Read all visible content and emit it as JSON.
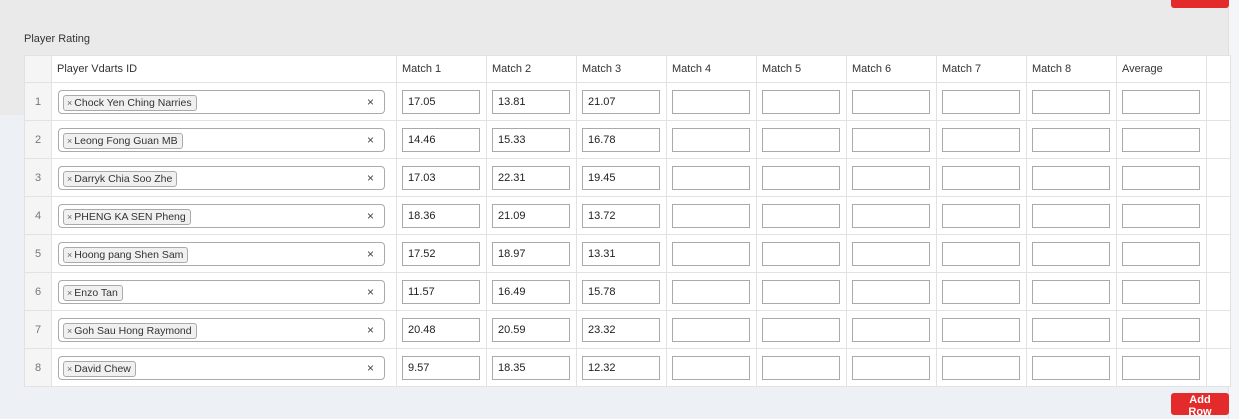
{
  "section_title": "Player Rating",
  "columns": {
    "player": "Player Vdarts ID",
    "matches": [
      "Match 1",
      "Match 2",
      "Match 3",
      "Match 4",
      "Match 5",
      "Match 6",
      "Match 7",
      "Match 8"
    ],
    "average": "Average"
  },
  "rows": [
    {
      "index": "1",
      "player": "Chock Yen Ching Narries",
      "scores": [
        "17.05",
        "13.81",
        "21.07",
        "",
        "",
        "",
        "",
        ""
      ],
      "average": ""
    },
    {
      "index": "2",
      "player": "Leong Fong Guan MB",
      "scores": [
        "14.46",
        "15.33",
        "16.78",
        "",
        "",
        "",
        "",
        ""
      ],
      "average": ""
    },
    {
      "index": "3",
      "player": "Darryk Chia Soo Zhe",
      "scores": [
        "17.03",
        "22.31",
        "19.45",
        "",
        "",
        "",
        "",
        ""
      ],
      "average": ""
    },
    {
      "index": "4",
      "player": "PHENG KA SEN Pheng",
      "scores": [
        "18.36",
        "21.09",
        "13.72",
        "",
        "",
        "",
        "",
        ""
      ],
      "average": ""
    },
    {
      "index": "5",
      "player": "Hoong pang Shen Sam",
      "scores": [
        "17.52",
        "18.97",
        "13.31",
        "",
        "",
        "",
        "",
        ""
      ],
      "average": ""
    },
    {
      "index": "6",
      "player": "Enzo Tan",
      "scores": [
        "11.57",
        "16.49",
        "15.78",
        "",
        "",
        "",
        "",
        ""
      ],
      "average": ""
    },
    {
      "index": "7",
      "player": "Goh Sau Hong Raymond",
      "scores": [
        "20.48",
        "20.59",
        "23.32",
        "",
        "",
        "",
        "",
        ""
      ],
      "average": ""
    },
    {
      "index": "8",
      "player": "David Chew",
      "scores": [
        "9.57",
        "18.35",
        "12.32",
        "",
        "",
        "",
        "",
        ""
      ],
      "average": ""
    }
  ],
  "tag_remove_glyph": "×",
  "clear_glyph": "×",
  "add_row_label": "Add Row",
  "colors": {
    "accent": "#e32b2b"
  }
}
